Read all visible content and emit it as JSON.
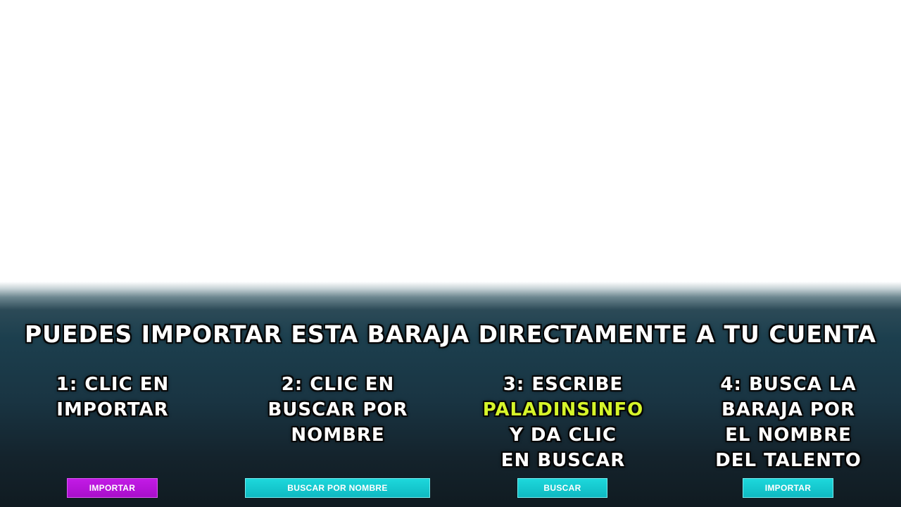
{
  "headline": "PUEDES IMPORTAR ESTA BARAJA DIRECTAMENTE A TU CUENTA",
  "steps": [
    {
      "lines": [
        "1: CLIC EN",
        "IMPORTAR"
      ]
    },
    {
      "lines": [
        "2: CLIC EN",
        "BUSCAR POR",
        "NOMBRE"
      ]
    },
    {
      "lines": [
        "3: ESCRIBE",
        "PALADINSINFO",
        "Y DA CLIC",
        "EN BUSCAR"
      ],
      "highlight_line_index": 1
    },
    {
      "lines": [
        "4: BUSCA LA",
        "BARAJA POR",
        "EL NOMBRE",
        "DEL TALENTO"
      ]
    }
  ],
  "buttons": {
    "importar_1": "IMPORTAR",
    "buscar_por_nombre": "BUSCAR POR NOMBRE",
    "buscar": "BUSCAR",
    "importar_2": "IMPORTAR"
  },
  "colors": {
    "highlight": "#d6f52a",
    "magenta_button": "#b812d6",
    "cyan_button": "#14c8d0"
  }
}
